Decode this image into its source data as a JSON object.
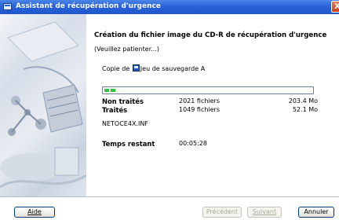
{
  "window": {
    "title": "Assistant de récupération d'urgence",
    "close_glyph": "X"
  },
  "main": {
    "heading": "Création du fichier image du CD-R de récupération d'urgence",
    "subheading": "(Veuillez patienter...)",
    "copy_prefix": "Copie de",
    "copy_item": "Jeu de sauvegarde A",
    "progress_fraction": 0.07,
    "stats": [
      {
        "label": "Non traités",
        "files": "2021 fichiers",
        "size": "203.4 Mo"
      },
      {
        "label": "Traités",
        "files": "1049 fichiers",
        "size": "52.1 Mo"
      }
    ],
    "current_file": "NETOCE4X.INF",
    "remaining_label": "Temps restant",
    "remaining_value": "00:05:28"
  },
  "buttons": {
    "help": "Aide",
    "previous": "Précédent",
    "next": "Suivant",
    "cancel": "Annuler"
  },
  "colors": {
    "titlebar": "#2a62d8",
    "progress": "#2fc13a"
  }
}
